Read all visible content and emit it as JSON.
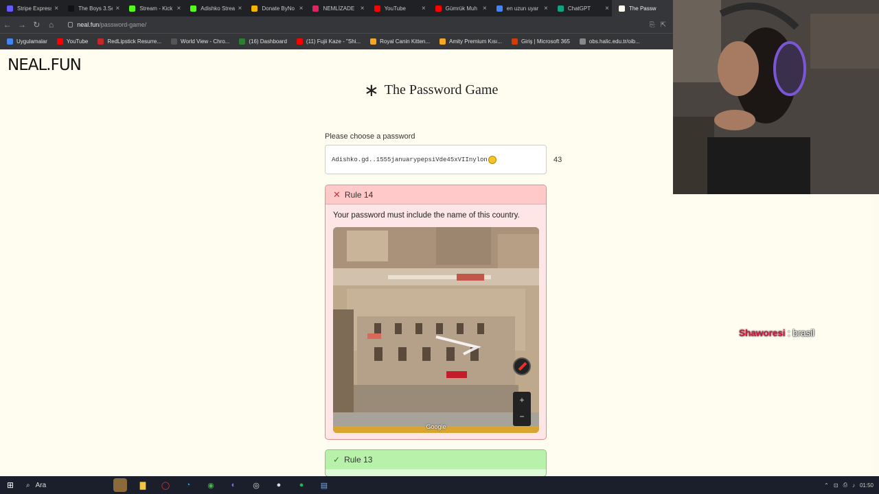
{
  "browser": {
    "tabs": [
      {
        "title": "Stripe Express",
        "color": "#635bff"
      },
      {
        "title": "The Boys 3.Se",
        "color": "#111111"
      },
      {
        "title": "Stream - Kick",
        "color": "#53fc18"
      },
      {
        "title": "Adishko Strea",
        "color": "#53fc18"
      },
      {
        "title": "Donate ByNo",
        "color": "#f5b400"
      },
      {
        "title": "NEMLİZADE",
        "color": "#e0245e"
      },
      {
        "title": "YouTube",
        "color": "#ff0000"
      },
      {
        "title": "Gümrük Muh",
        "color": "#ff0000"
      },
      {
        "title": "en uzun uyar",
        "color": "#4285f4"
      },
      {
        "title": "ChatGPT",
        "color": "#10a37f"
      },
      {
        "title": "The Passw",
        "color": "#fffdf0"
      }
    ],
    "url_host": "neal.fun",
    "url_path": "/password-game/",
    "bookmarks": [
      {
        "label": "Uygulamalar",
        "color": "#4285f4"
      },
      {
        "label": "YouTube",
        "color": "#ff0000"
      },
      {
        "label": "RedLipstick Resurre...",
        "color": "#c62828"
      },
      {
        "label": "World View - Chro...",
        "color": "#555555"
      },
      {
        "label": "(16) Dashboard",
        "color": "#2e7d32"
      },
      {
        "label": "(11) Fujii Kaze - \"Shi...",
        "color": "#ff0000"
      },
      {
        "label": "Royal Canin Kitten...",
        "color": "#f5a623"
      },
      {
        "label": "Amity Premium Kısı...",
        "color": "#f5a623"
      },
      {
        "label": "Giriş | Microsoft 365",
        "color": "#d83b01"
      },
      {
        "label": "obs.halic.edu.tr/oib...",
        "color": "#888888"
      }
    ]
  },
  "page": {
    "logo": "NEAL.FUN",
    "title": "The Password Game",
    "password_label": "Please choose a password",
    "password_value": "Adishko.gd..1555januarypepsiVde45xVIInylon",
    "char_count": "43"
  },
  "rules": {
    "rule14": {
      "label": "Rule 14",
      "text": "Your password must include the name of this country.",
      "map_brand": "Google"
    },
    "rule13": {
      "label": "Rule 13"
    }
  },
  "overlay": {
    "chat_user": "Shaworesi",
    "chat_message": " : brasil"
  },
  "taskbar": {
    "search_label": "Ara",
    "clock": "01:50"
  }
}
